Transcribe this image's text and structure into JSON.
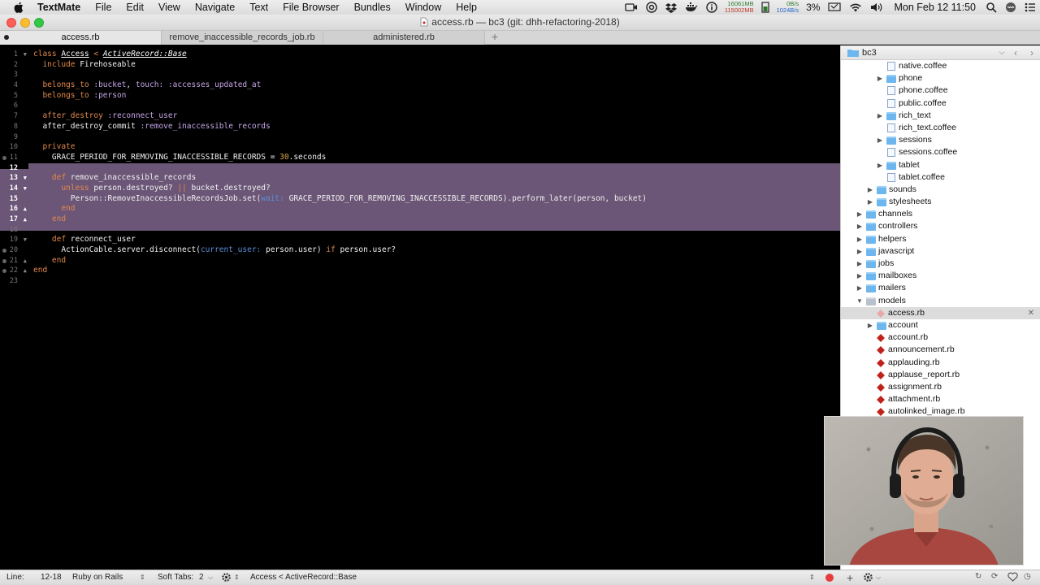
{
  "menubar": {
    "app_name": "TextMate",
    "items": [
      "File",
      "Edit",
      "View",
      "Navigate",
      "Text",
      "File Browser",
      "Bundles",
      "Window",
      "Help"
    ],
    "memory_top": "16061MB",
    "memory_bottom": "115002MB",
    "net_up": "0B/s",
    "net_down": "1024B/s",
    "battery": "3%",
    "clock": "Mon Feb 12  11:50"
  },
  "window": {
    "title": "access.rb — bc3 (git: dhh-refactoring-2018)"
  },
  "tabs": [
    {
      "label": "access.rb",
      "active": true,
      "dirty": true
    },
    {
      "label": "remove_inaccessible_records_job.rb",
      "active": false,
      "dirty": false
    },
    {
      "label": "administered.rb",
      "active": false,
      "dirty": false
    }
  ],
  "tab_add_label": "+",
  "editor": {
    "line_numbers": [
      "1",
      "2",
      "3",
      "4",
      "5",
      "6",
      "7",
      "8",
      "9",
      "10",
      "11",
      "12",
      "13",
      "14",
      "15",
      "16",
      "17",
      "18",
      "19",
      "20",
      "21",
      "22",
      "23"
    ]
  },
  "sidebar": {
    "project": "bc3",
    "items": [
      {
        "label": "native.coffee"
      },
      {
        "label": "phone"
      },
      {
        "label": "phone.coffee"
      },
      {
        "label": "public.coffee"
      },
      {
        "label": "rich_text"
      },
      {
        "label": "rich_text.coffee"
      },
      {
        "label": "sessions"
      },
      {
        "label": "sessions.coffee"
      },
      {
        "label": "tablet"
      },
      {
        "label": "tablet.coffee"
      },
      {
        "label": "sounds"
      },
      {
        "label": "stylesheets"
      },
      {
        "label": "channels"
      },
      {
        "label": "controllers"
      },
      {
        "label": "helpers"
      },
      {
        "label": "javascript"
      },
      {
        "label": "jobs"
      },
      {
        "label": "mailboxes"
      },
      {
        "label": "mailers"
      },
      {
        "label": "models"
      },
      {
        "label": "access.rb"
      },
      {
        "label": "account"
      },
      {
        "label": "account.rb"
      },
      {
        "label": "announcement.rb"
      },
      {
        "label": "applauding.rb"
      },
      {
        "label": "applause_report.rb"
      },
      {
        "label": "assignment.rb"
      },
      {
        "label": "attachment.rb"
      },
      {
        "label": "autolinked_image.rb"
      }
    ]
  },
  "statusbar": {
    "line_label": "Line:",
    "line_value": "12-18",
    "grammar": "Ruby on Rails",
    "soft_tabs_label": "Soft Tabs:",
    "soft_tabs_value": "2",
    "symbol": "Access < ActiveRecord::Base"
  },
  "code": {
    "l1": {
      "a": "class ",
      "b": "Access",
      "c": " < ",
      "d": "ActiveRecord::Base"
    },
    "l2": {
      "a": "  include ",
      "b": "Firehoseable"
    },
    "l4": {
      "a": "  belongs_to ",
      "b": ":bucket",
      "c": ", ",
      "d": "touch:",
      "e": " :accesses_updated_at"
    },
    "l5": {
      "a": "  belongs_to ",
      "b": ":person"
    },
    "l7": {
      "a": "  after_destroy ",
      "b": ":reconnect_user"
    },
    "l8": {
      "a": "  after_destroy_commit ",
      "b": ":remove_inaccessible_records"
    },
    "l10": {
      "a": "  private"
    },
    "l11": {
      "a": "    GRACE_PERIOD_FOR_REMOVING_INACCESSIBLE_RECORDS = ",
      "b": "30",
      "c": ".seconds"
    },
    "l13": {
      "a": "    def ",
      "b": "remove_inaccessible_records"
    },
    "l14": {
      "a": "      unless ",
      "b": "person.destroyed? ",
      "c": "||",
      "d": " bucket.destroyed?"
    },
    "l15": {
      "a": "        Person::RemoveInaccessibleRecordsJob.set(",
      "b": "wait:",
      "c": " GRACE_PERIOD_FOR_REMOVING_INACCESSIBLE_RECORDS).perform_later(person, bucket)"
    },
    "l16": {
      "a": "      end"
    },
    "l17": {
      "a": "    end"
    },
    "l19": {
      "a": "    def ",
      "b": "reconnect_user"
    },
    "l20": {
      "a": "      ActionCable.server.disconnect(",
      "b": "current_user:",
      "c": " person.user) ",
      "d": "if",
      "e": " person.user?"
    },
    "l21": {
      "a": "    end"
    },
    "l22": {
      "a": "end"
    }
  }
}
